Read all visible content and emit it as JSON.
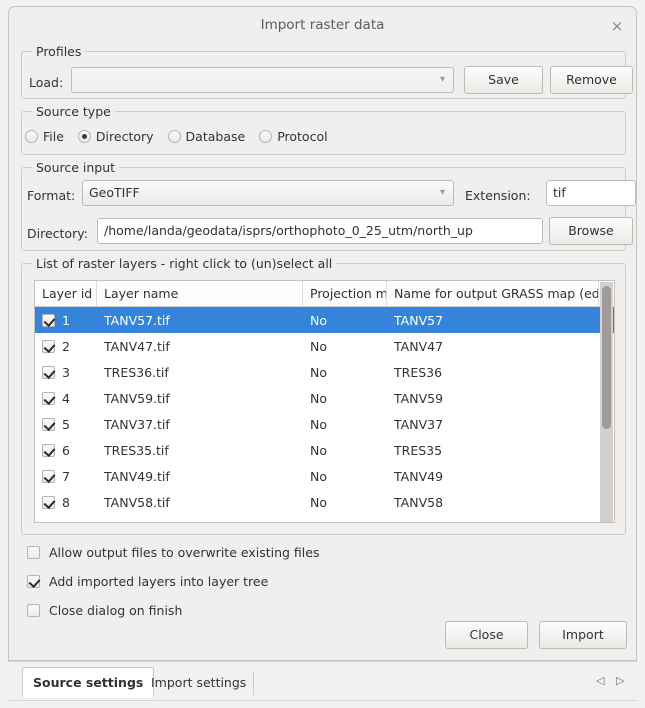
{
  "window": {
    "title": "Import raster data",
    "close_icon": "close-icon",
    "close_glyph": "×"
  },
  "profiles": {
    "legend": "Profiles",
    "load_label": "Load:",
    "load_value": "",
    "load_placeholder": "",
    "save_label": "Save",
    "remove_label": "Remove"
  },
  "source_type": {
    "legend": "Source type",
    "selected": "Directory",
    "options": [
      {
        "label": "File",
        "selected": false
      },
      {
        "label": "Directory",
        "selected": true
      },
      {
        "label": "Database",
        "selected": false
      },
      {
        "label": "Protocol",
        "selected": false
      }
    ]
  },
  "source_input": {
    "legend": "Source input",
    "format_label": "Format:",
    "format_value": "GeoTIFF",
    "extension_label": "Extension:",
    "extension_value": "tif",
    "directory_label": "Directory:",
    "directory_value": "/home/landa/geodata/isprs/orthophoto_0_25_utm/north_up",
    "browse_label": "Browse"
  },
  "layers": {
    "legend": "List of raster layers - right click to (un)select all",
    "columns": [
      "Layer id",
      "Layer name",
      "Projection ma",
      "Name for output GRASS map (ed"
    ],
    "rows": [
      {
        "id": "1",
        "checked": true,
        "name": "TANV57.tif",
        "projection_match": "No",
        "output_name": "TANV57",
        "selected": true
      },
      {
        "id": "2",
        "checked": true,
        "name": "TANV47.tif",
        "projection_match": "No",
        "output_name": "TANV47",
        "selected": false
      },
      {
        "id": "3",
        "checked": true,
        "name": "TRES36.tif",
        "projection_match": "No",
        "output_name": "TRES36",
        "selected": false
      },
      {
        "id": "4",
        "checked": true,
        "name": "TANV59.tif",
        "projection_match": "No",
        "output_name": "TANV59",
        "selected": false
      },
      {
        "id": "5",
        "checked": true,
        "name": "TANV37.tif",
        "projection_match": "No",
        "output_name": "TANV37",
        "selected": false
      },
      {
        "id": "6",
        "checked": true,
        "name": "TRES35.tif",
        "projection_match": "No",
        "output_name": "TRES35",
        "selected": false
      },
      {
        "id": "7",
        "checked": true,
        "name": "TANV49.tif",
        "projection_match": "No",
        "output_name": "TANV49",
        "selected": false
      },
      {
        "id": "8",
        "checked": true,
        "name": "TANV58.tif",
        "projection_match": "No",
        "output_name": "TANV58",
        "selected": false
      }
    ]
  },
  "options": [
    {
      "label": "Allow output files to overwrite existing files",
      "checked": false
    },
    {
      "label": "Add imported layers into layer tree",
      "checked": true
    },
    {
      "label": "Close dialog on finish",
      "checked": false
    }
  ],
  "actions": {
    "close_label": "Close",
    "import_label": "Import"
  },
  "tabs": {
    "items": [
      {
        "label": "Source settings",
        "active": true
      },
      {
        "label": "Import settings",
        "active": false
      }
    ],
    "prev_glyph": "◁",
    "next_glyph": "▷"
  },
  "colors": {
    "selection": "#3584dc",
    "dialog_bg": "#f0efee",
    "field_bg": "#ffffff"
  }
}
